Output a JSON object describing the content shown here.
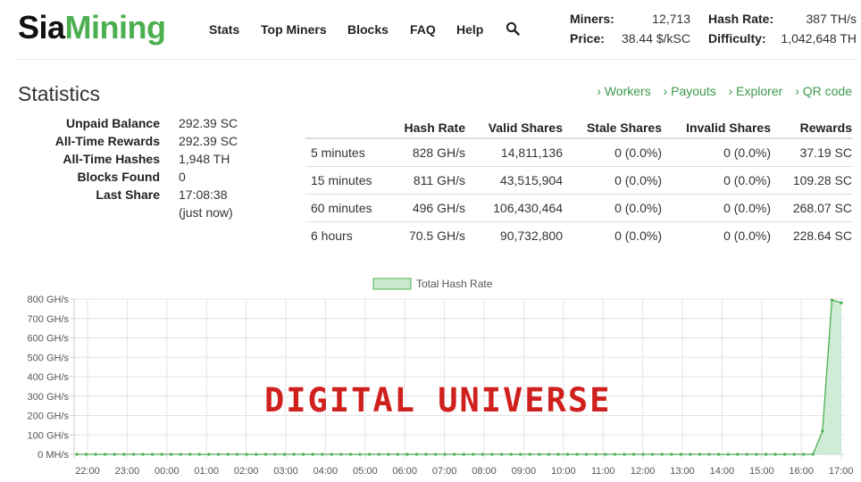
{
  "header": {
    "logo_part1": "Sia",
    "logo_part2": "Mining",
    "nav": [
      "Stats",
      "Top Miners",
      "Blocks",
      "FAQ",
      "Help"
    ],
    "miners_label": "Miners:",
    "miners_value": "12,713",
    "price_label": "Price:",
    "price_value": "38.44 $/kSC",
    "hashrate_label": "Hash Rate:",
    "hashrate_value": "387 TH/s",
    "difficulty_label": "Difficulty:",
    "difficulty_value": "1,042,648 TH"
  },
  "page": {
    "title": "Statistics",
    "links": [
      "› Workers",
      "› Payouts",
      "› Explorer",
      "› QR code"
    ]
  },
  "summary": {
    "unpaid_label": "Unpaid Balance",
    "unpaid_value": "292.39 SC",
    "alltime_rewards_label": "All-Time Rewards",
    "alltime_rewards_value": "292.39 SC",
    "alltime_hashes_label": "All-Time Hashes",
    "alltime_hashes_value": "1,948 TH",
    "blocks_label": "Blocks Found",
    "blocks_value": "0",
    "last_share_label": "Last Share",
    "last_share_value": "17:08:38",
    "last_share_note": "(just now)"
  },
  "table": {
    "headers": [
      "",
      "Hash Rate",
      "Valid Shares",
      "Stale Shares",
      "Invalid Shares",
      "Rewards"
    ],
    "rows": [
      [
        "5 minutes",
        "828 GH/s",
        "14,811,136",
        "0 (0.0%)",
        "0 (0.0%)",
        "37.19 SC"
      ],
      [
        "15 minutes",
        "811 GH/s",
        "43,515,904",
        "0 (0.0%)",
        "0 (0.0%)",
        "109.28 SC"
      ],
      [
        "60 minutes",
        "496 GH/s",
        "106,430,464",
        "0 (0.0%)",
        "0 (0.0%)",
        "268.07 SC"
      ],
      [
        "6 hours",
        "70.5 GH/s",
        "90,732,800",
        "0 (0.0%)",
        "0 (0.0%)",
        "228.64 SC"
      ]
    ]
  },
  "watermark": "DIGITAL UNIVERSE",
  "colors": {
    "accent": "#4caf50",
    "link": "#3c9a4b",
    "series_line": "#4caf50",
    "series_fill": "#c8e9cf",
    "watermark": "#d0201e"
  },
  "chart_data": {
    "type": "area",
    "legend": "Total Hash Rate",
    "legend_position": "top",
    "grid": true,
    "y_unit": "GH/s",
    "ylim": [
      0,
      800
    ],
    "y_ticks": [
      "0 MH/s",
      "100 GH/s",
      "200 GH/s",
      "300 GH/s",
      "400 GH/s",
      "500 GH/s",
      "600 GH/s",
      "700 GH/s",
      "800 GH/s"
    ],
    "x_ticks": [
      "22:00",
      "23:00",
      "00:00",
      "01:00",
      "02:00",
      "03:00",
      "04:00",
      "05:00",
      "06:00",
      "07:00",
      "08:00",
      "09:00",
      "10:00",
      "11:00",
      "12:00",
      "13:00",
      "14:00",
      "15:00",
      "16:00",
      "17:00"
    ],
    "series": [
      {
        "name": "Total Hash Rate",
        "values": [
          0,
          0,
          0,
          0,
          0,
          0,
          0,
          0,
          0,
          0,
          0,
          0,
          0,
          0,
          0,
          0,
          0,
          0,
          0,
          0,
          0,
          0,
          0,
          0,
          0,
          0,
          0,
          0,
          0,
          0,
          0,
          0,
          0,
          0,
          0,
          0,
          0,
          0,
          0,
          0,
          0,
          0,
          0,
          0,
          0,
          0,
          0,
          0,
          0,
          0,
          0,
          0,
          0,
          0,
          0,
          0,
          0,
          0,
          0,
          0,
          0,
          0,
          0,
          0,
          0,
          0,
          0,
          0,
          0,
          0,
          0,
          0,
          0,
          0,
          0,
          0,
          0,
          0,
          0,
          120,
          795,
          780
        ]
      }
    ]
  }
}
